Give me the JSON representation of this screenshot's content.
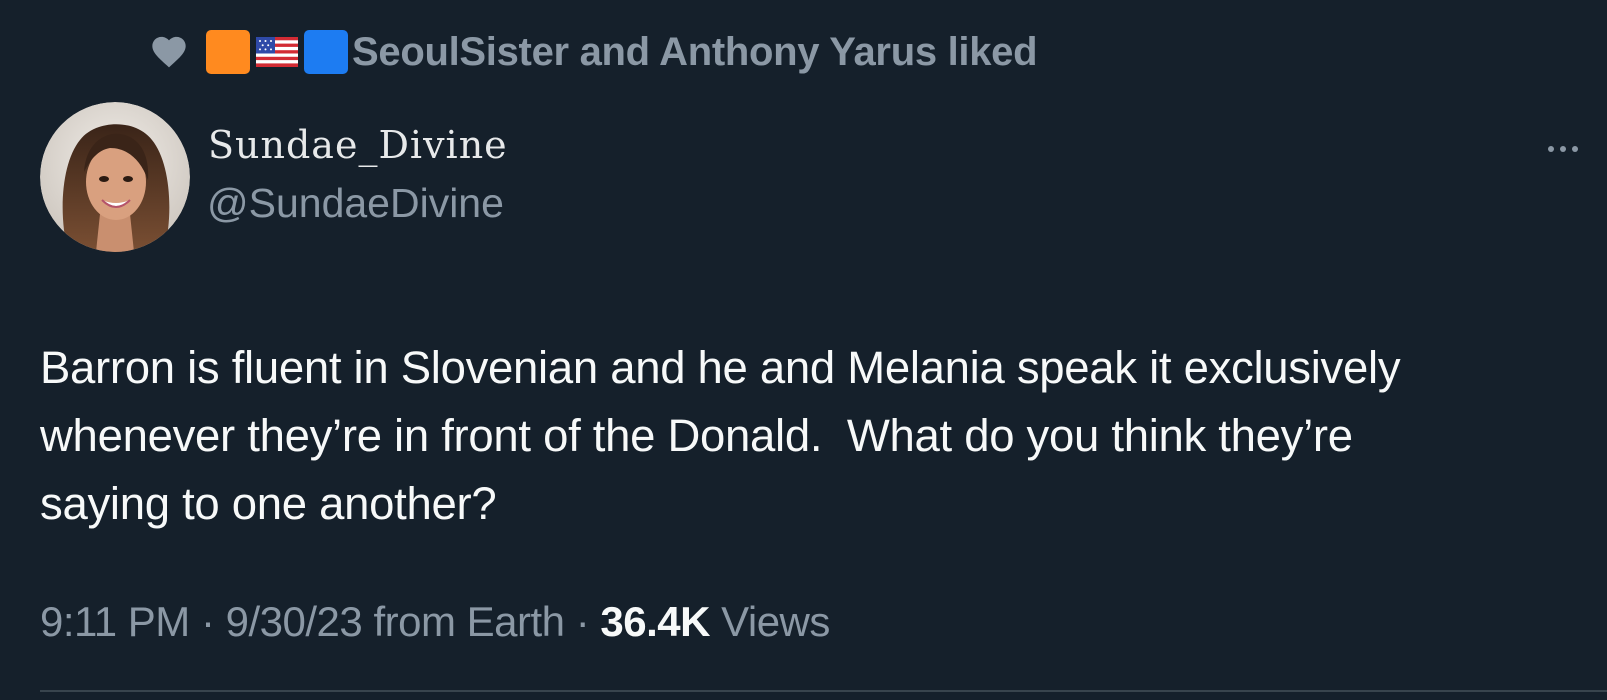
{
  "social_context": {
    "icon": "heart-icon",
    "emoji_icons": [
      "orange-square-icon",
      "us-flag-icon",
      "blue-square-icon"
    ],
    "liked_text": "SeoulSister and Anthony Yarus liked"
  },
  "author": {
    "display_name": "Sundae_Divine",
    "handle": "@SundaeDivine",
    "avatar_icon": "avatar"
  },
  "tweet": {
    "text_lines": [
      "Barron is fluent in Slovenian and he and Melania speak it exclusively",
      "whenever they’re in front of the Donald.  What do you think they’re",
      "saying to one another?"
    ]
  },
  "meta": {
    "time": "9:11 PM",
    "date": "9/30/23",
    "source": "from Earth",
    "separator": "·",
    "views_count": "36.4K",
    "views_label": "Views"
  },
  "colors": {
    "background": "#15202b",
    "primary_text": "#e7e9ea",
    "secondary_text": "#8b98a5",
    "orange_square": "#ff8a1f",
    "blue_square": "#1d7cf2"
  }
}
